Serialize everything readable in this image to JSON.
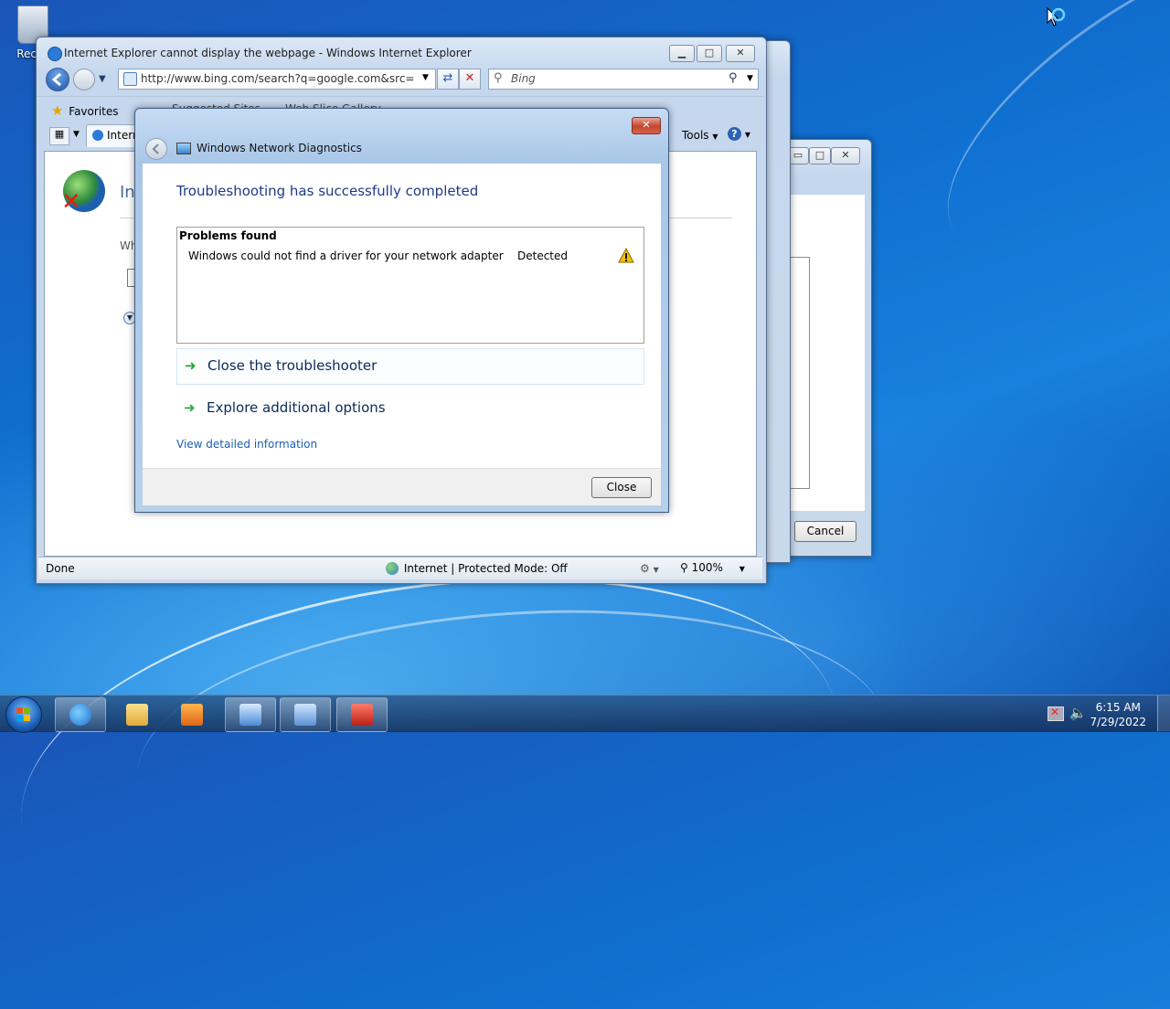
{
  "desktop": {
    "recycle_label": "Recyc"
  },
  "ie": {
    "title": "Internet Explorer cannot display the webpage - Windows Internet Explorer",
    "address": "http://www.bing.com/search?q=google.com&src=IE-Sea",
    "search_placeholder": "Bing",
    "favorites_label": "Favorites",
    "suggested_sites": "Suggested Sites",
    "web_slice": "Web Slice Gallery",
    "tab_label": "Intern",
    "tools_label": "Tools",
    "content_heading": "Int",
    "content_text": "Wh",
    "status_done": "Done",
    "status_zone": "Internet | Protected Mode: Off",
    "zoom": "100%"
  },
  "background_window": {
    "cancel_label": "Cancel"
  },
  "dialog": {
    "title": "Windows Network Diagnostics",
    "heading": "Troubleshooting has successfully completed",
    "problems_header": "Problems found",
    "problems": [
      {
        "description": "Windows could not find a driver for your network adapter",
        "status": "Detected"
      }
    ],
    "option_close": "Close the troubleshooter",
    "option_explore": "Explore additional options",
    "details_link": "View detailed information",
    "close_button": "Close"
  },
  "taskbar": {
    "time": "6:15 AM",
    "date": "7/29/2022"
  },
  "colors": {
    "accent_blue": "#1e3a8a",
    "link_blue": "#1a5fb4",
    "arrow_green": "#2aa53a",
    "warning_yellow": "#f2c200"
  },
  "icons": [
    "recycle-bin-icon",
    "ie-icon",
    "back-icon",
    "forward-icon",
    "refresh-icon",
    "stop-icon",
    "search-icon",
    "favorites-star-icon",
    "help-icon",
    "globe-error-icon",
    "warning-icon",
    "arrow-right-icon",
    "start-orb-icon",
    "folder-icon",
    "media-player-icon",
    "network-icon",
    "toolbox-icon",
    "speaker-icon",
    "busy-cursor-icon"
  ]
}
